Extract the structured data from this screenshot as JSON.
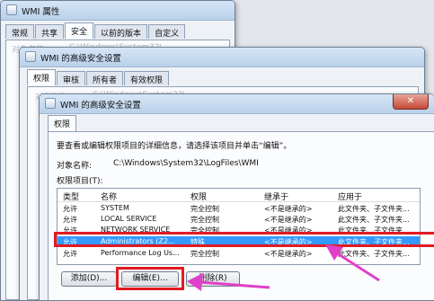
{
  "win1": {
    "title": "WMI 属性",
    "tabs": [
      "常规",
      "共享",
      "安全",
      "以前的版本",
      "自定义"
    ],
    "active_tab": "安全",
    "ghost_label": "对象名称:",
    "ghost_value": "C:\\Windows\\System32\\..."
  },
  "win2": {
    "title": "WMI 的高级安全设置",
    "tabs": [
      "权限",
      "审核",
      "所有者",
      "有效权限"
    ],
    "active_tab": "权限",
    "ghost_label": "对象名称:",
    "ghost_value": "C:\\Windows\\System32\\..."
  },
  "win3": {
    "title": "WMI 的高级安全设置",
    "tab": "权限",
    "instruction": "要查看或编辑权限项目的详细信息，请选择该项目并单击“编辑”。",
    "object_label": "对象名称:",
    "object_value": "C:\\Windows\\System32\\LogFiles\\WMI",
    "entries_label": "权限项目(T):",
    "columns": [
      "类型",
      "名称",
      "权限",
      "继承于",
      "应用于"
    ],
    "rows": [
      [
        "允许",
        "SYSTEM",
        "完全控制",
        "<不是继承的>",
        "此文件夹、子文件夹..."
      ],
      [
        "允许",
        "LOCAL SERVICE",
        "完全控制",
        "<不是继承的>",
        "此文件夹、子文件夹..."
      ],
      [
        "允许",
        "NETWORK SERVICE",
        "完全控制",
        "<不是继承的>",
        "此文件夹、子文件夹..."
      ],
      [
        "允许",
        "Administrators (Z2...",
        "特殊",
        "<不是继承的>",
        "此文件夹、子文件夹..."
      ],
      [
        "允许",
        "Performance Log Us...",
        "完全控制",
        "<不是继承的>",
        "此文件夹、子文件夹..."
      ]
    ],
    "selected_row": 3,
    "buttons": {
      "add": "添加(D)...",
      "edit": "编辑(E)...",
      "delete": "删除(R)"
    }
  },
  "colors": {
    "highlight_box": "#e11b22",
    "arrow": "#e040c8",
    "selection": "#3399ff"
  }
}
